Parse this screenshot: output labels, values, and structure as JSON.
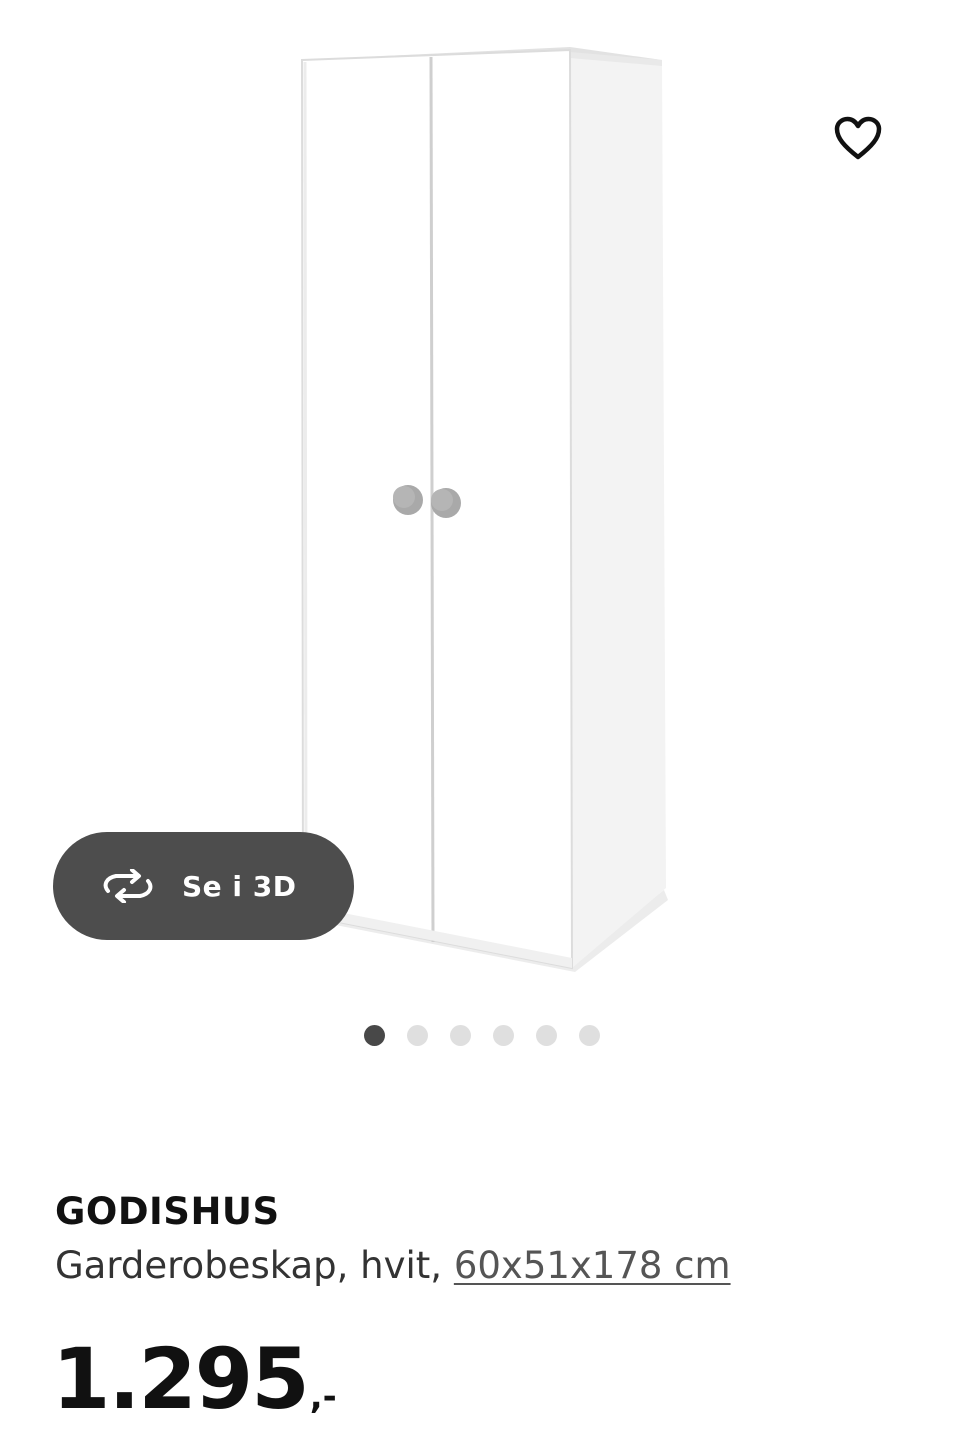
{
  "gallery": {
    "image_icon": "wardrobe-product-photo",
    "favorite_icon": "heart-outline-icon",
    "view3d": {
      "icon": "rotate-3d-icon",
      "label": "Se i 3D"
    },
    "dots": {
      "count": 6,
      "active_index": 0
    }
  },
  "product": {
    "name": "GODISHUS",
    "description": "Garderobeskap, hvit,",
    "measurements": "60x51x178 cm",
    "price": {
      "amount": "1.295",
      "suffix": ",-"
    }
  },
  "colors": {
    "badge_bg": "#4d4d4d",
    "dot_active": "#484848",
    "dot_inactive": "#dfdfdf"
  }
}
